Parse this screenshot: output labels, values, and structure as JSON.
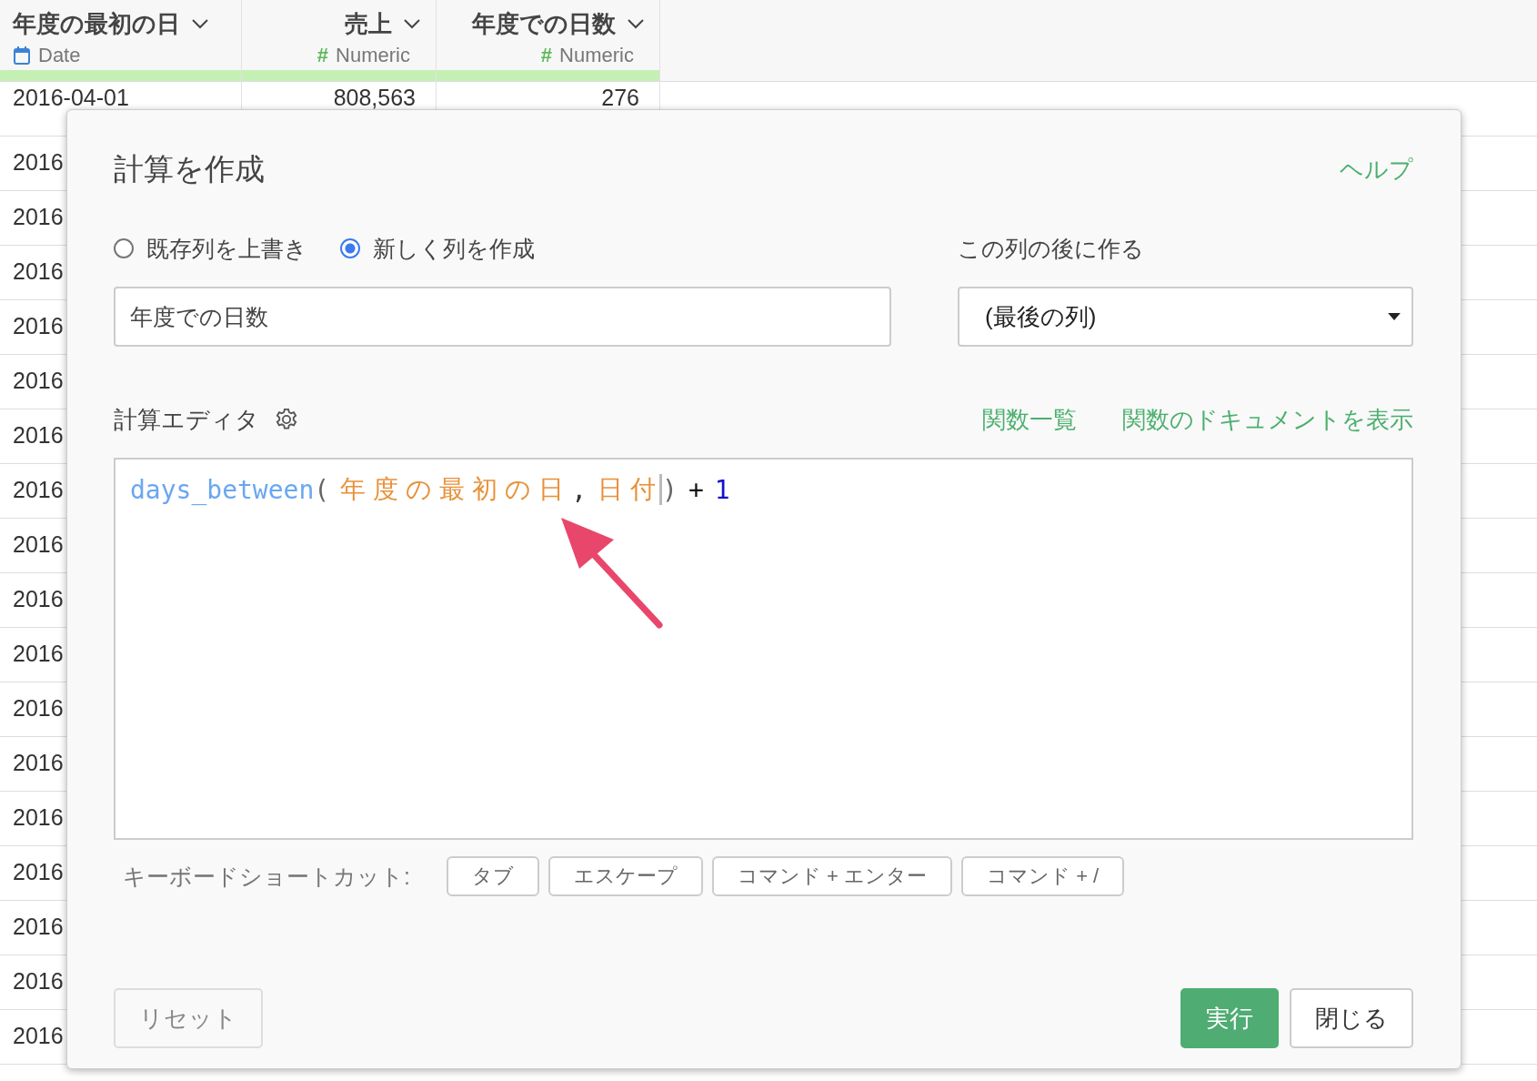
{
  "table": {
    "columns": [
      {
        "title": "年度の最初の日",
        "type": {
          "kind": "date",
          "label": "Date"
        }
      },
      {
        "title": "売上",
        "type": {
          "kind": "numeric",
          "symbol": "#",
          "label": "Numeric"
        }
      },
      {
        "title": "年度での日数",
        "type": {
          "kind": "numeric",
          "symbol": "#",
          "label": "Numeric"
        }
      }
    ],
    "rows": [
      [
        "2016-04-01",
        "808,563",
        "276"
      ],
      [
        "2016"
      ],
      [
        "2016"
      ],
      [
        "2016"
      ],
      [
        "2016"
      ],
      [
        "2016"
      ],
      [
        "2016"
      ],
      [
        "2016"
      ],
      [
        "2016"
      ],
      [
        "2016"
      ],
      [
        "2016"
      ],
      [
        "2016"
      ],
      [
        "2016"
      ],
      [
        "2016"
      ],
      [
        "2016"
      ],
      [
        "2016"
      ],
      [
        "2016"
      ],
      [
        "2016"
      ]
    ]
  },
  "dialog": {
    "title": "計算を作成",
    "help_link": "ヘルプ",
    "mode_options": [
      {
        "label": "既存列を上書き",
        "selected": false
      },
      {
        "label": "新しく列を作成",
        "selected": true
      }
    ],
    "column_name": {
      "value": "年度での日数"
    },
    "position": {
      "label": "この列の後に作る",
      "value": "(最後の列)"
    },
    "editor": {
      "label": "計算エディタ",
      "links": [
        "関数一覧",
        "関数のドキュメントを表示"
      ],
      "tokens": [
        {
          "kind": "function",
          "text": "days_between",
          "cursor": false
        },
        {
          "kind": "paren",
          "text": "(",
          "cursor": false
        },
        {
          "kind": "column",
          "text": "年度の最初の日",
          "cursor": false
        },
        {
          "kind": "comma",
          "text": ",",
          "cursor": false
        },
        {
          "kind": "column",
          "text": "日付",
          "cursor": true
        },
        {
          "kind": "paren",
          "text": ")",
          "cursor": false
        },
        {
          "kind": "operator",
          "text": "+",
          "cursor": false
        },
        {
          "kind": "number",
          "text": "1",
          "cursor": false
        }
      ]
    },
    "shortcuts": {
      "label": "キーボードショートカット:",
      "keys": [
        "タブ",
        "エスケープ",
        "コマンド + エンター",
        "コマンド + /"
      ]
    },
    "buttons": [
      {
        "kind": "secondary",
        "label": "リセット"
      },
      {
        "kind": "primary",
        "label": "実行"
      },
      {
        "kind": "default",
        "label": "閉じる"
      }
    ]
  }
}
